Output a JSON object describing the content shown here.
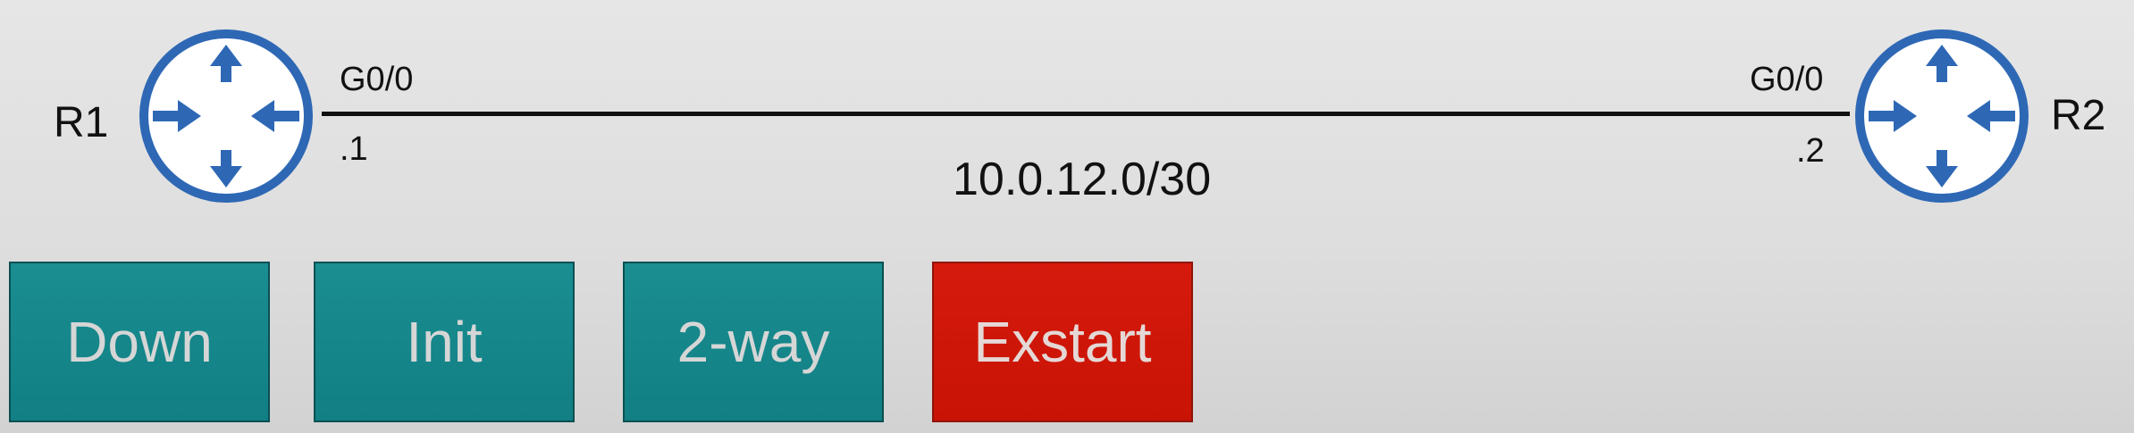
{
  "diagram": {
    "routers": [
      {
        "name": "R1",
        "interface": "G0/0",
        "address": ".1"
      },
      {
        "name": "R2",
        "interface": "G0/0",
        "address": ".2"
      }
    ],
    "link": {
      "subnet": "10.0.12.0/30"
    },
    "router_icon": "router-icon",
    "colors": {
      "router_blue": "#2e68b5",
      "state_teal": "#138689",
      "state_red": "#cf1709",
      "line": "#111111"
    }
  },
  "states": [
    {
      "label": "Down",
      "color": "teal"
    },
    {
      "label": "Init",
      "color": "teal"
    },
    {
      "label": "2-way",
      "color": "teal"
    },
    {
      "label": "Exstart",
      "color": "red"
    }
  ]
}
